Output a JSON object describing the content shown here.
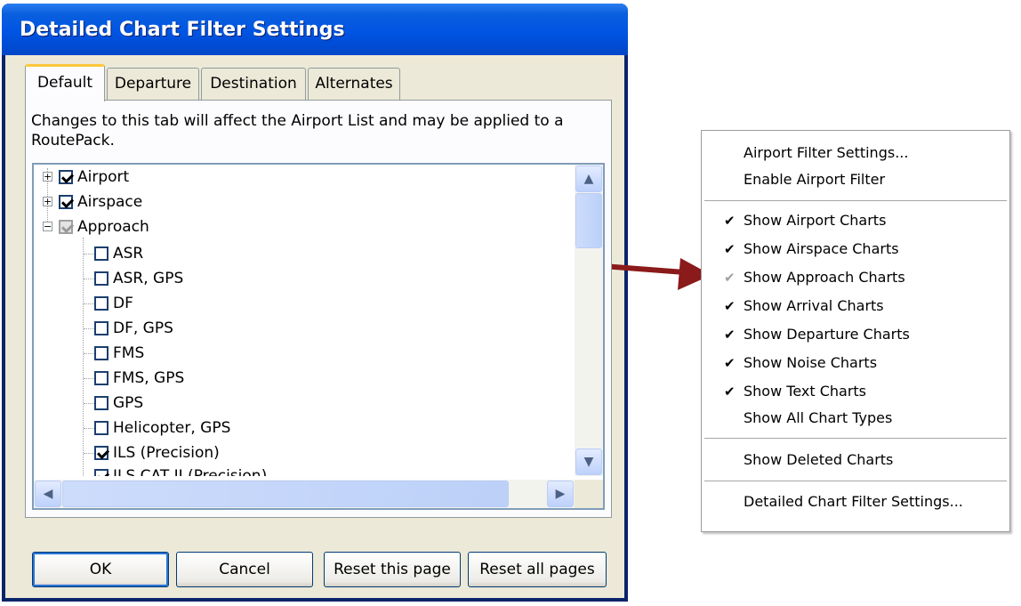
{
  "dialog": {
    "title": "Detailed Chart Filter Settings",
    "tabs": [
      {
        "label": "Default",
        "active": true
      },
      {
        "label": "Departure",
        "active": false
      },
      {
        "label": "Destination",
        "active": false
      },
      {
        "label": "Alternates",
        "active": false
      }
    ],
    "description": "Changes to this tab will affect the Airport List and may be applied to a RoutePack.",
    "tree": {
      "nodes": [
        {
          "label": "Airport",
          "checked": true,
          "expander": "+"
        },
        {
          "label": "Airspace",
          "checked": true,
          "expander": "+"
        },
        {
          "label": "Approach",
          "checked": "partial",
          "expander": "−"
        },
        {
          "label": "ASR",
          "checked": false
        },
        {
          "label": "ASR, GPS",
          "checked": false
        },
        {
          "label": "DF",
          "checked": false
        },
        {
          "label": "DF, GPS",
          "checked": false
        },
        {
          "label": "FMS",
          "checked": false
        },
        {
          "label": "FMS, GPS",
          "checked": false
        },
        {
          "label": "GPS",
          "checked": false
        },
        {
          "label": "Helicopter, GPS",
          "checked": false
        },
        {
          "label": "ILS (Precision)",
          "checked": true
        },
        {
          "label": "ILS CAT II (Precision)",
          "checked": true
        }
      ]
    },
    "buttons": {
      "ok": "OK",
      "cancel": "Cancel",
      "reset_page": "Reset this page",
      "reset_all": "Reset all pages"
    }
  },
  "menu": {
    "items": [
      {
        "label": "Airport Filter Settings...",
        "check": ""
      },
      {
        "label": "Enable Airport Filter",
        "check": ""
      },
      {
        "label": "Show Airport Charts",
        "check": "✔"
      },
      {
        "label": "Show Airspace Charts",
        "check": "✔"
      },
      {
        "label": "Show Approach Charts",
        "check": "✔",
        "grey": true
      },
      {
        "label": "Show Arrival Charts",
        "check": "✔"
      },
      {
        "label": "Show Departure Charts",
        "check": "✔"
      },
      {
        "label": "Show Noise Charts",
        "check": "✔"
      },
      {
        "label": "Show Text Charts",
        "check": "✔"
      },
      {
        "label": "Show All Chart Types",
        "check": ""
      },
      {
        "label": "Show Deleted Charts",
        "check": ""
      },
      {
        "label": "Detailed Chart Filter Settings...",
        "check": ""
      }
    ]
  },
  "colors": {
    "titlebar": "#0054e3",
    "dialog_face": "#ece9d8",
    "arrow": "#8b1a1a",
    "tab_highlight": "#ffc83c"
  },
  "icons": {
    "scroll_up": "▲",
    "scroll_down": "▼",
    "scroll_left": "◀",
    "scroll_right": "▶"
  }
}
